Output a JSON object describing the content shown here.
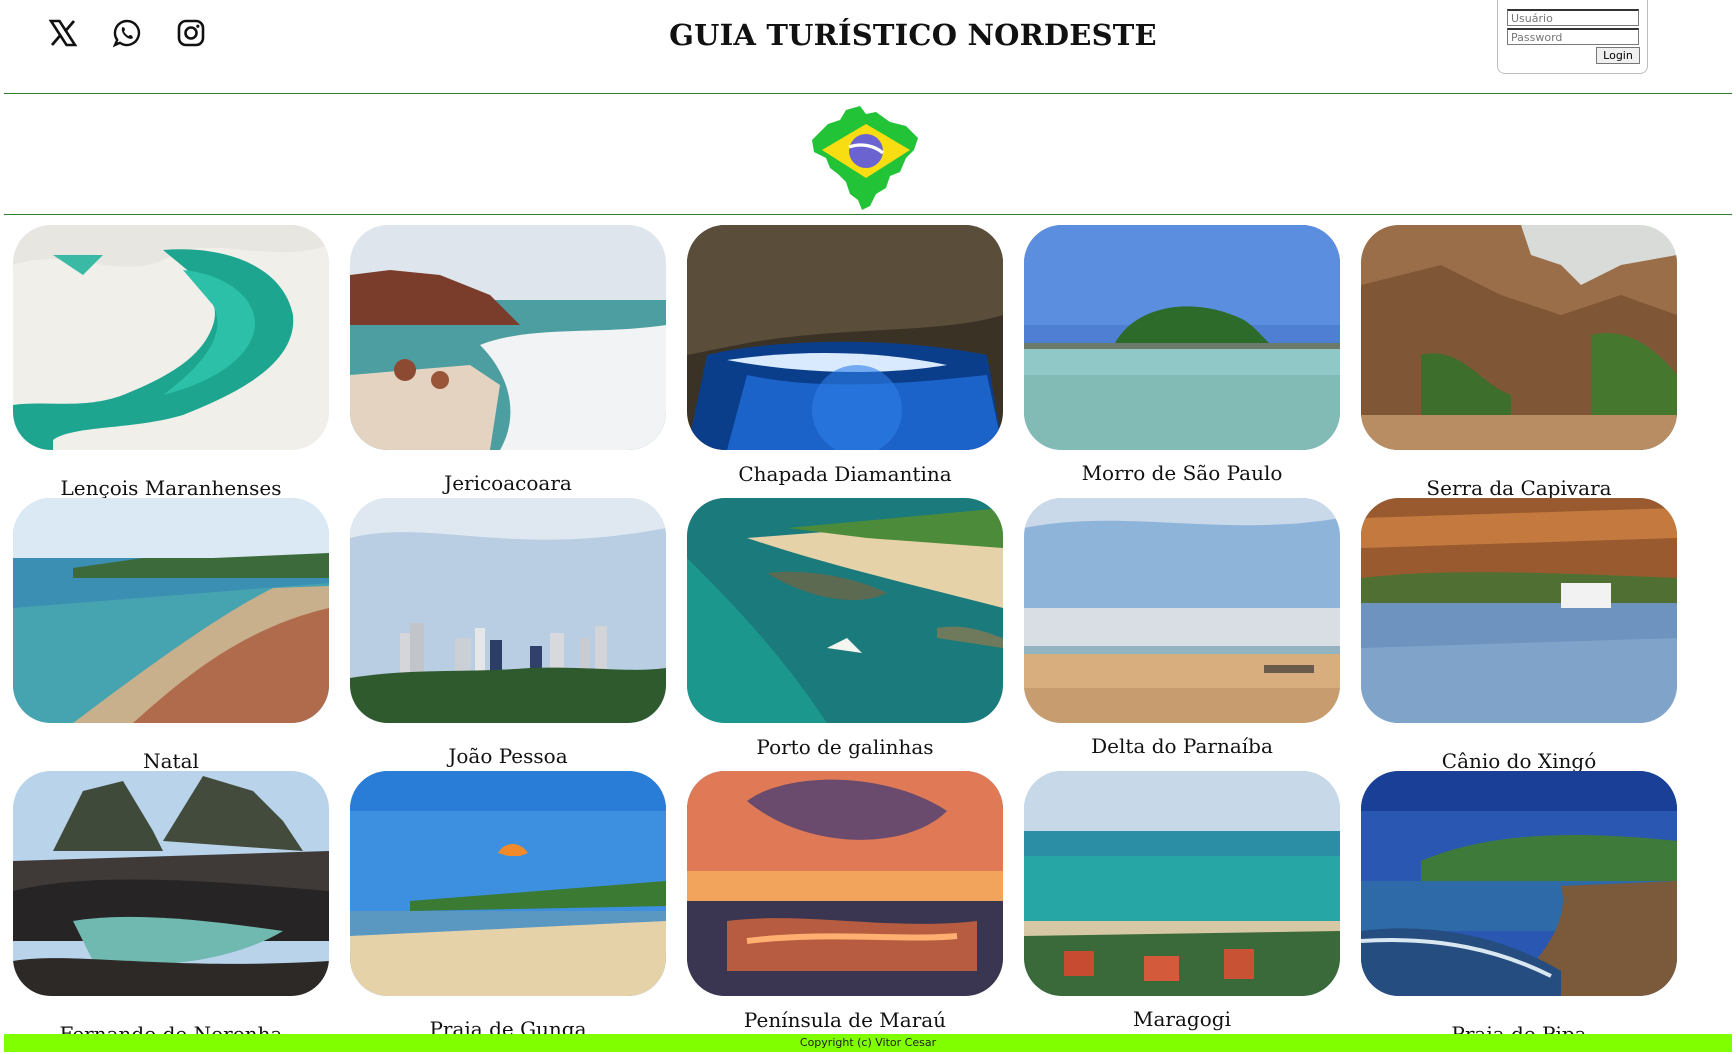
{
  "header": {
    "title": "GUIA TURÍSTICO NORDESTE",
    "social": [
      "x-icon",
      "whatsapp-icon",
      "instagram-icon"
    ]
  },
  "login": {
    "user_placeholder": "Usuário",
    "password_placeholder": "Password",
    "button_label": "Login"
  },
  "destinations": [
    {
      "name": "Lençois Maranhenses"
    },
    {
      "name": "Jericoacoara"
    },
    {
      "name": "Chapada Diamantina"
    },
    {
      "name": "Morro de São Paulo"
    },
    {
      "name": "Serra da Capivara"
    },
    {
      "name": "Natal"
    },
    {
      "name": "João Pessoa"
    },
    {
      "name": "Porto de galinhas"
    },
    {
      "name": "Delta do Parnaíba"
    },
    {
      "name": "Cânio do Xingó"
    },
    {
      "name": "Fernando de Noronha"
    },
    {
      "name": "Praia de Gunga"
    },
    {
      "name": "Península de Maraú"
    },
    {
      "name": "Maragogi"
    },
    {
      "name": "Praia de Pipa"
    }
  ],
  "footer": {
    "copyright": "Copyright (c) Vitor Cesar"
  },
  "colors": {
    "rule": "#2e7d32",
    "footer": "#80ff00"
  }
}
